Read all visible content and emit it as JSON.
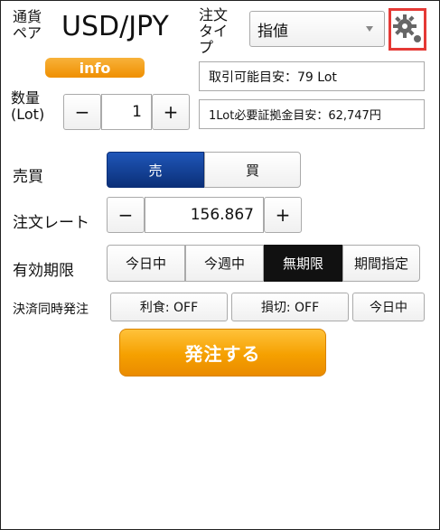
{
  "header": {
    "pair_label": "通貨\nペア",
    "pair": "USD/JPY",
    "order_type_label": "注文\nタイプ",
    "order_type_value": "指値",
    "info_button": "info"
  },
  "info": {
    "tradable_estimate": "取引可能目安：79 Lot",
    "margin_estimate": "1Lot必要証拠金目安：62,747円"
  },
  "quantity": {
    "label": "数量\n(Lot)",
    "value": "1",
    "minus": "−",
    "plus": "+"
  },
  "side": {
    "label": "売買",
    "sell": "売",
    "buy": "買"
  },
  "rate": {
    "label": "注文レート",
    "value": "156.867",
    "minus": "−",
    "plus": "+"
  },
  "expiry": {
    "label": "有効期限",
    "options": [
      "今日中",
      "今週中",
      "無期限",
      "期間指定"
    ],
    "selected": "無期限"
  },
  "settlement": {
    "label": "決済同時発注",
    "take_profit": "利食: OFF",
    "stop_loss": "損切: OFF",
    "period": "今日中"
  },
  "submit": "発注する",
  "colors": {
    "selected_sell": "#0f3d91",
    "submit": "#f5a000",
    "info": "#f39c12",
    "highlight": "#e53935"
  },
  "icons": {
    "settings": "gear-icon",
    "dropdown": "chevron-down-icon"
  }
}
